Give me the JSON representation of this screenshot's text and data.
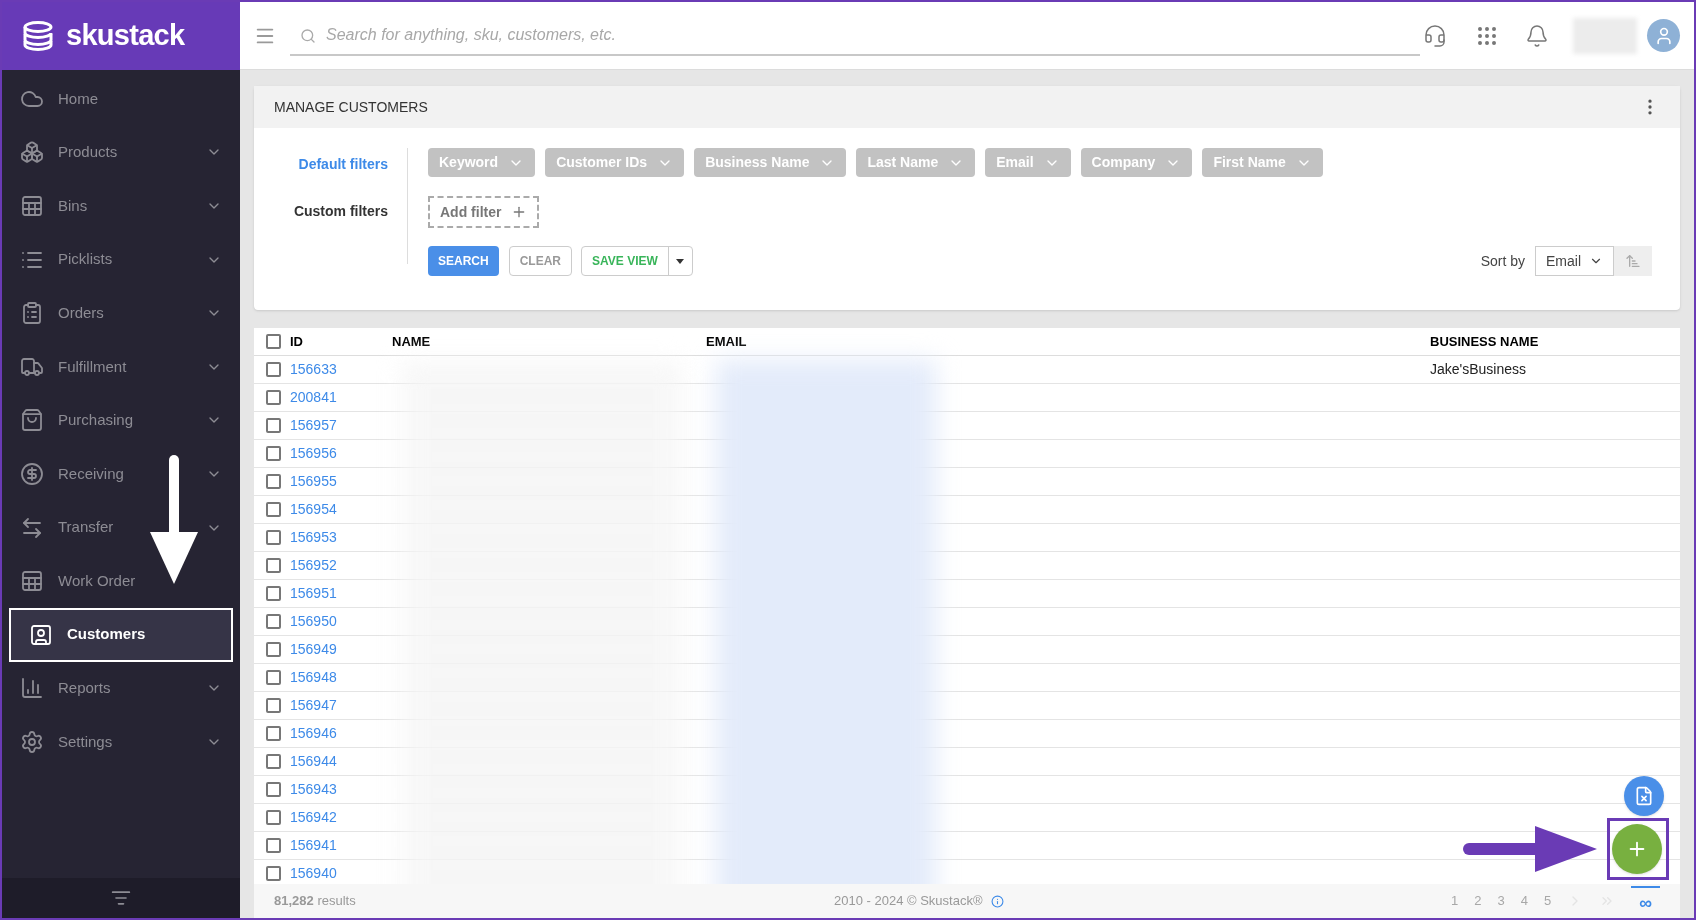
{
  "brand": {
    "name": "skustack"
  },
  "sidebar": {
    "items": [
      {
        "label": "Home",
        "has_submenu": false,
        "selected": false
      },
      {
        "label": "Products",
        "has_submenu": true,
        "selected": false
      },
      {
        "label": "Bins",
        "has_submenu": true,
        "selected": false
      },
      {
        "label": "Picklists",
        "has_submenu": true,
        "selected": false
      },
      {
        "label": "Orders",
        "has_submenu": true,
        "selected": false
      },
      {
        "label": "Fulfillment",
        "has_submenu": true,
        "selected": false
      },
      {
        "label": "Purchasing",
        "has_submenu": true,
        "selected": false
      },
      {
        "label": "Receiving",
        "has_submenu": true,
        "selected": false
      },
      {
        "label": "Transfer",
        "has_submenu": true,
        "selected": false
      },
      {
        "label": "Work Order",
        "has_submenu": false,
        "selected": false
      },
      {
        "label": "Customers",
        "has_submenu": false,
        "selected": true
      },
      {
        "label": "Reports",
        "has_submenu": true,
        "selected": false
      },
      {
        "label": "Settings",
        "has_submenu": true,
        "selected": false
      }
    ]
  },
  "topbar": {
    "search": {
      "placeholder": "Search for anything, sku, customers, etc."
    }
  },
  "panel": {
    "title": "MANAGE CUSTOMERS",
    "default_filters_label": "Default filters",
    "custom_filters_label": "Custom filters",
    "filter_chips": [
      "Keyword",
      "Customer IDs",
      "Business Name",
      "Last Name",
      "Email",
      "Company",
      "First Name"
    ],
    "add_filter": "Add filter",
    "buttons": {
      "search": "SEARCH",
      "clear": "CLEAR",
      "save_view": "SAVE VIEW"
    },
    "sort": {
      "label": "Sort by",
      "value": "Email"
    }
  },
  "table": {
    "columns": [
      "ID",
      "NAME",
      "EMAIL",
      "BUSINESS NAME"
    ],
    "select_all_checked": false,
    "rows": [
      {
        "id": "156633",
        "business_name": "Jake'sBusiness",
        "checked": false
      },
      {
        "id": "200841",
        "checked": false
      },
      {
        "id": "156957",
        "checked": false
      },
      {
        "id": "156956",
        "checked": false
      },
      {
        "id": "156955",
        "checked": false
      },
      {
        "id": "156954",
        "checked": false
      },
      {
        "id": "156953",
        "checked": false
      },
      {
        "id": "156952",
        "checked": false
      },
      {
        "id": "156951",
        "checked": false
      },
      {
        "id": "156950",
        "checked": false
      },
      {
        "id": "156949",
        "checked": false
      },
      {
        "id": "156948",
        "checked": false
      },
      {
        "id": "156947",
        "checked": false
      },
      {
        "id": "156946",
        "checked": false
      },
      {
        "id": "156944",
        "checked": false
      },
      {
        "id": "156943",
        "checked": false
      },
      {
        "id": "156942",
        "checked": false
      },
      {
        "id": "156941",
        "checked": false
      },
      {
        "id": "156940",
        "checked": false
      }
    ]
  },
  "footer": {
    "results": "81,282 results",
    "copyright": "2010 - 2024 © Skustack®",
    "pages": [
      {
        "label": "1",
        "selected": false
      },
      {
        "label": "2",
        "selected": false
      },
      {
        "label": "3",
        "selected": false
      },
      {
        "label": "4",
        "selected": false
      },
      {
        "label": "5",
        "selected": false
      },
      {
        "label": "∞",
        "selected": true
      }
    ]
  }
}
